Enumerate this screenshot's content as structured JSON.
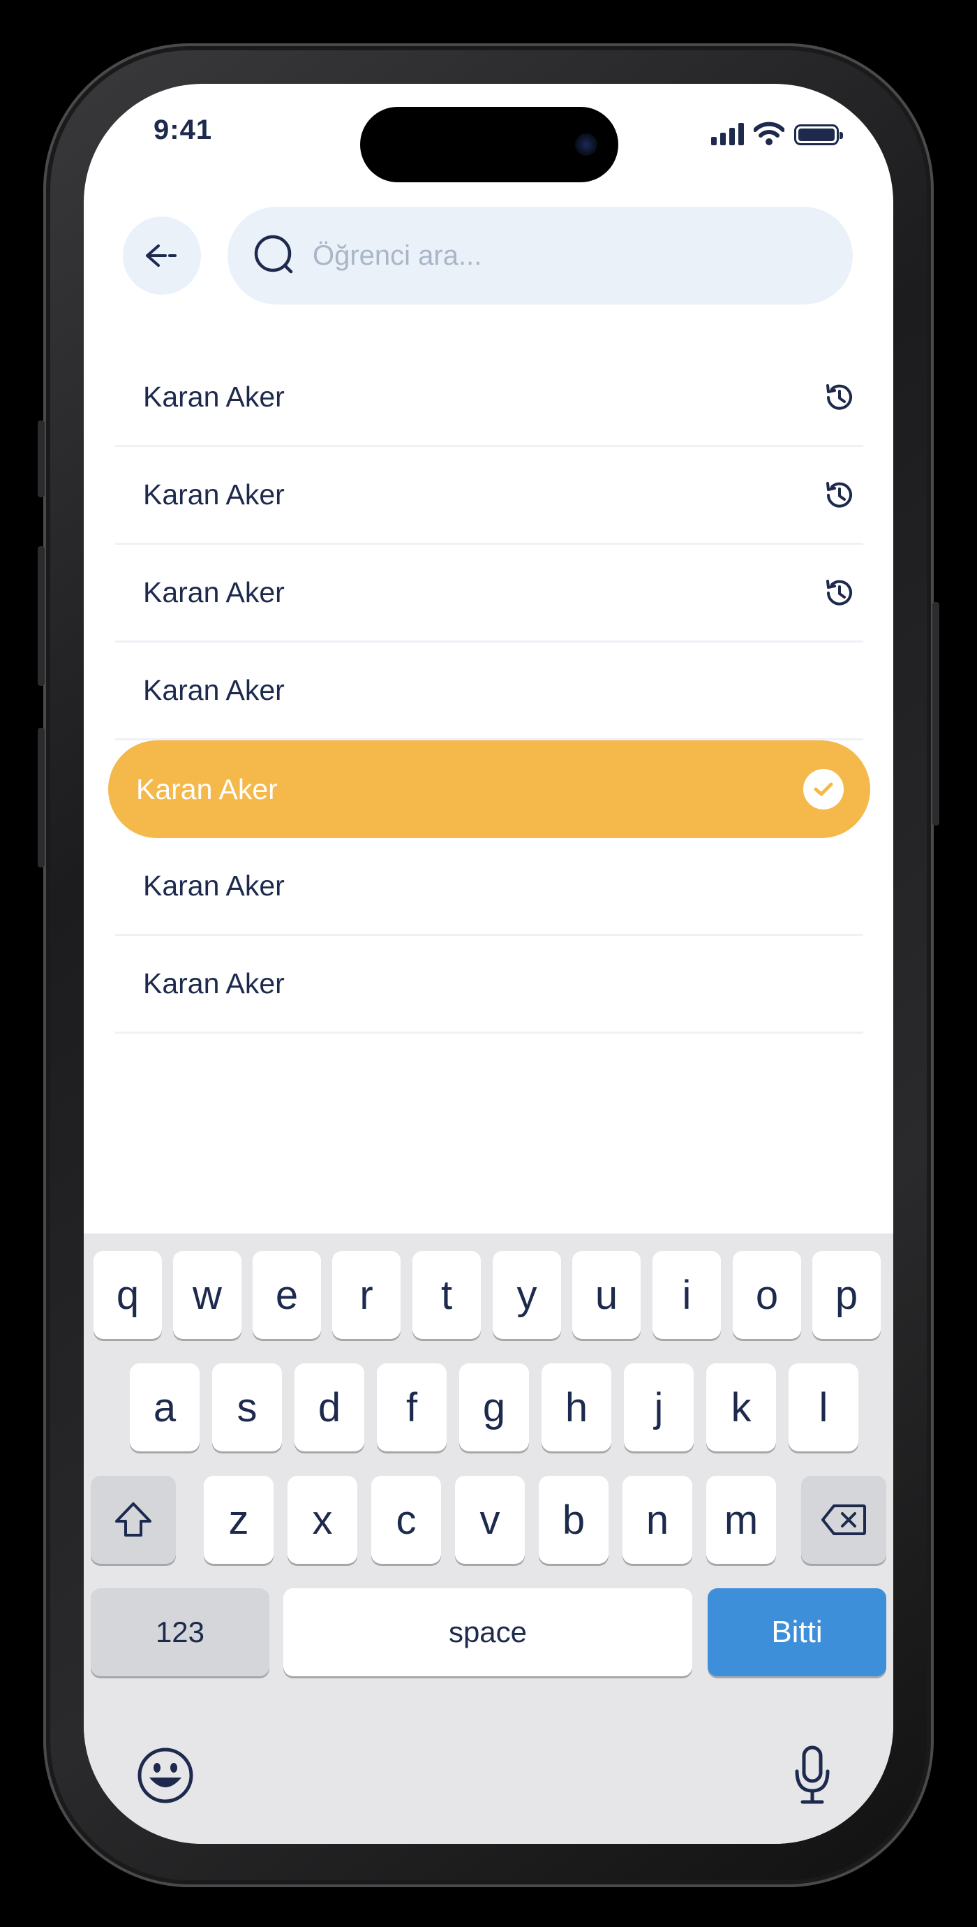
{
  "status_bar": {
    "time": "9:41"
  },
  "header": {
    "search_placeholder": "Öğrenci ara..."
  },
  "list": [
    {
      "name": "Karan Aker",
      "history": true,
      "selected": false
    },
    {
      "name": "Karan Aker",
      "history": true,
      "selected": false
    },
    {
      "name": "Karan Aker",
      "history": true,
      "selected": false
    },
    {
      "name": "Karan Aker",
      "history": false,
      "selected": false
    },
    {
      "name": "Karan Aker",
      "history": false,
      "selected": true
    },
    {
      "name": "Karan Aker",
      "history": false,
      "selected": false
    },
    {
      "name": "Karan Aker",
      "history": false,
      "selected": false
    }
  ],
  "keyboard": {
    "row1": [
      "q",
      "w",
      "e",
      "r",
      "t",
      "y",
      "u",
      "i",
      "o",
      "p"
    ],
    "row2": [
      "a",
      "s",
      "d",
      "f",
      "g",
      "h",
      "j",
      "k",
      "l"
    ],
    "row3": [
      "z",
      "x",
      "c",
      "v",
      "b",
      "n",
      "m"
    ],
    "numbers_label": "123",
    "space_label": "space",
    "done_label": "Bitti"
  },
  "colors": {
    "accent": "#f5b84a",
    "primary_text": "#1d2a4d",
    "done_button": "#3e8fda",
    "search_bg": "#eaf1f9"
  },
  "icons": [
    "back-arrow-icon",
    "search-icon",
    "history-icon",
    "check-icon",
    "shift-icon",
    "backspace-icon",
    "emoji-icon",
    "microphone-icon"
  ]
}
